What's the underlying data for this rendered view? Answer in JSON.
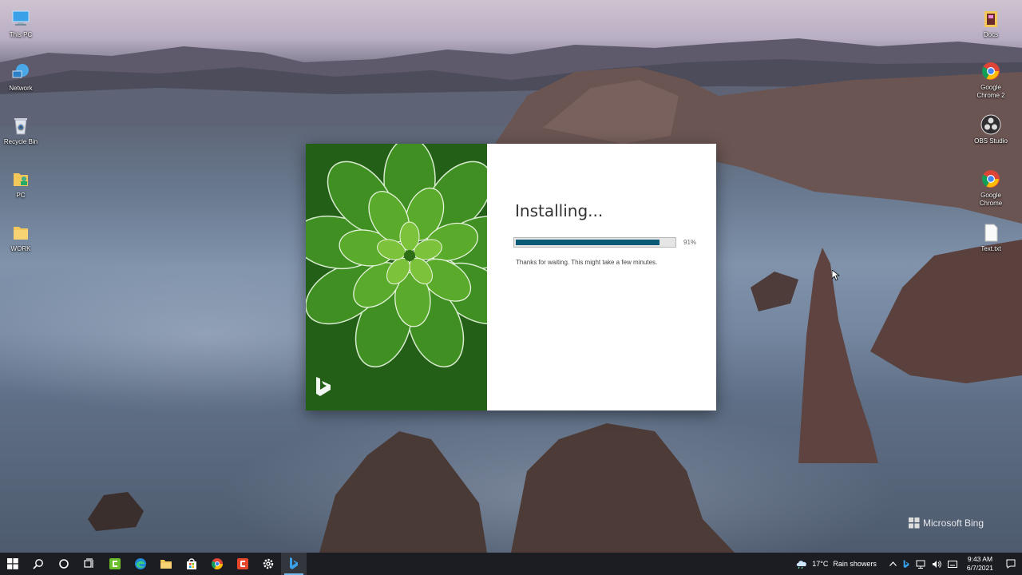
{
  "desktop": {
    "left_icons": [
      {
        "label": "This PC",
        "icon": "computer-icon"
      },
      {
        "label": "Network",
        "icon": "network-icon"
      },
      {
        "label": "Recycle Bin",
        "icon": "recycle-bin-icon"
      },
      {
        "label": "PC",
        "icon": "user-folder-icon"
      },
      {
        "label": "WORK",
        "icon": "folder-icon"
      }
    ],
    "right_icons": [
      {
        "label": "Docs",
        "icon": "folder-icon"
      },
      {
        "label": "Google Chrome 2",
        "icon": "chrome-icon"
      },
      {
        "label": "OBS Studio",
        "icon": "obs-icon"
      },
      {
        "label": "Google Chrome",
        "icon": "chrome-icon"
      },
      {
        "label": "Text.txt",
        "icon": "text-file-icon"
      }
    ]
  },
  "installer": {
    "title": "Installing...",
    "progress_percent": 91,
    "progress_label": "91%",
    "message": "Thanks for waiting. This might take a few minutes.",
    "brand_icon": "bing-logo-icon"
  },
  "watermark": {
    "label": "Microsoft Bing"
  },
  "taskbar": {
    "buttons": [
      "start-icon",
      "search-icon",
      "cortana-icon",
      "task-view-icon",
      "app-icon",
      "edge-icon",
      "file-explorer-icon",
      "store-icon",
      "chrome-icon",
      "app-red-icon",
      "settings-icon",
      "bing-icon"
    ],
    "weather_temp": "17°C",
    "weather_text": "Rain showers",
    "time": "9:43 AM",
    "date": "6/7/2021"
  },
  "colors": {
    "progress": "#0a5b76",
    "taskbar": "#1b1d23",
    "active_indicator": "#76b9ed"
  }
}
